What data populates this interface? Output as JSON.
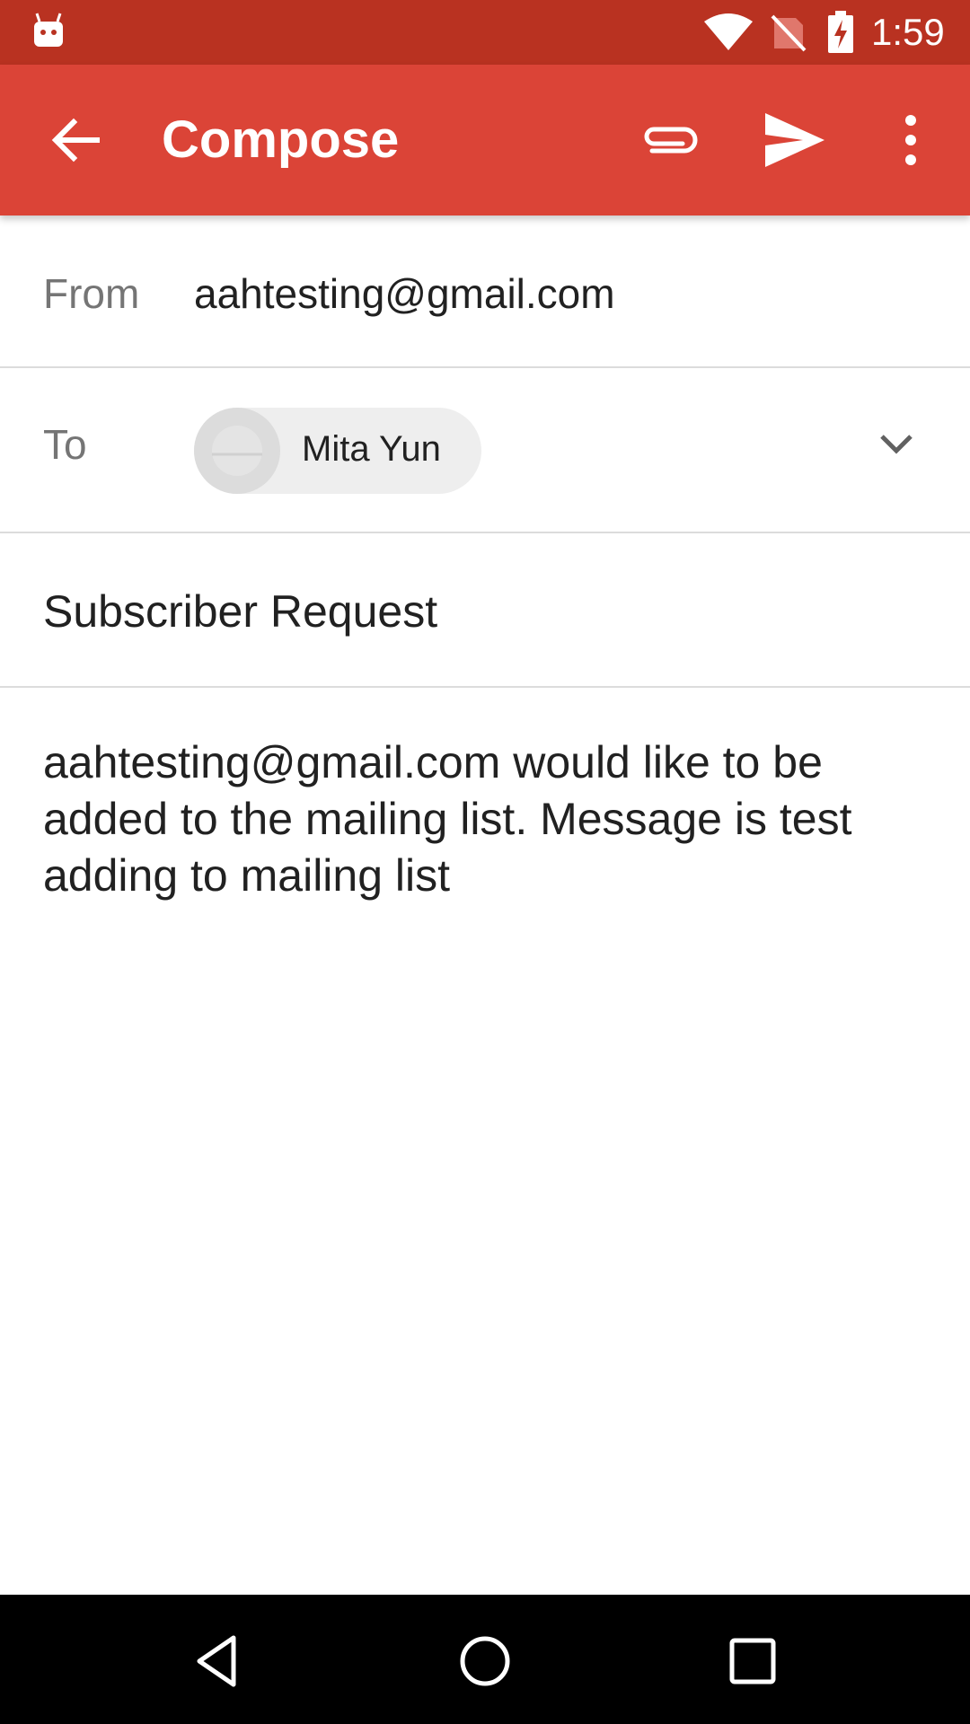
{
  "status_bar": {
    "time": "1:59",
    "icons": [
      "android-icon",
      "wifi-icon",
      "no-signal-icon",
      "battery-charging-icon"
    ]
  },
  "app_bar": {
    "title": "Compose",
    "icons": [
      "back-arrow-icon",
      "attach-icon",
      "send-icon",
      "more-vert-icon"
    ],
    "color": "#db4437"
  },
  "compose": {
    "from_label": "From",
    "from_value": "aahtesting@gmail.com",
    "to_label": "To",
    "to_recipient": "Mita Yun",
    "subject": "Subscriber Request",
    "body": "aahtesting@gmail.com would like to be added to the mailing list. Message is test adding to mailing list"
  },
  "nav_bar": {
    "icons": [
      "nav-back-icon",
      "nav-home-icon",
      "nav-recents-icon"
    ]
  }
}
